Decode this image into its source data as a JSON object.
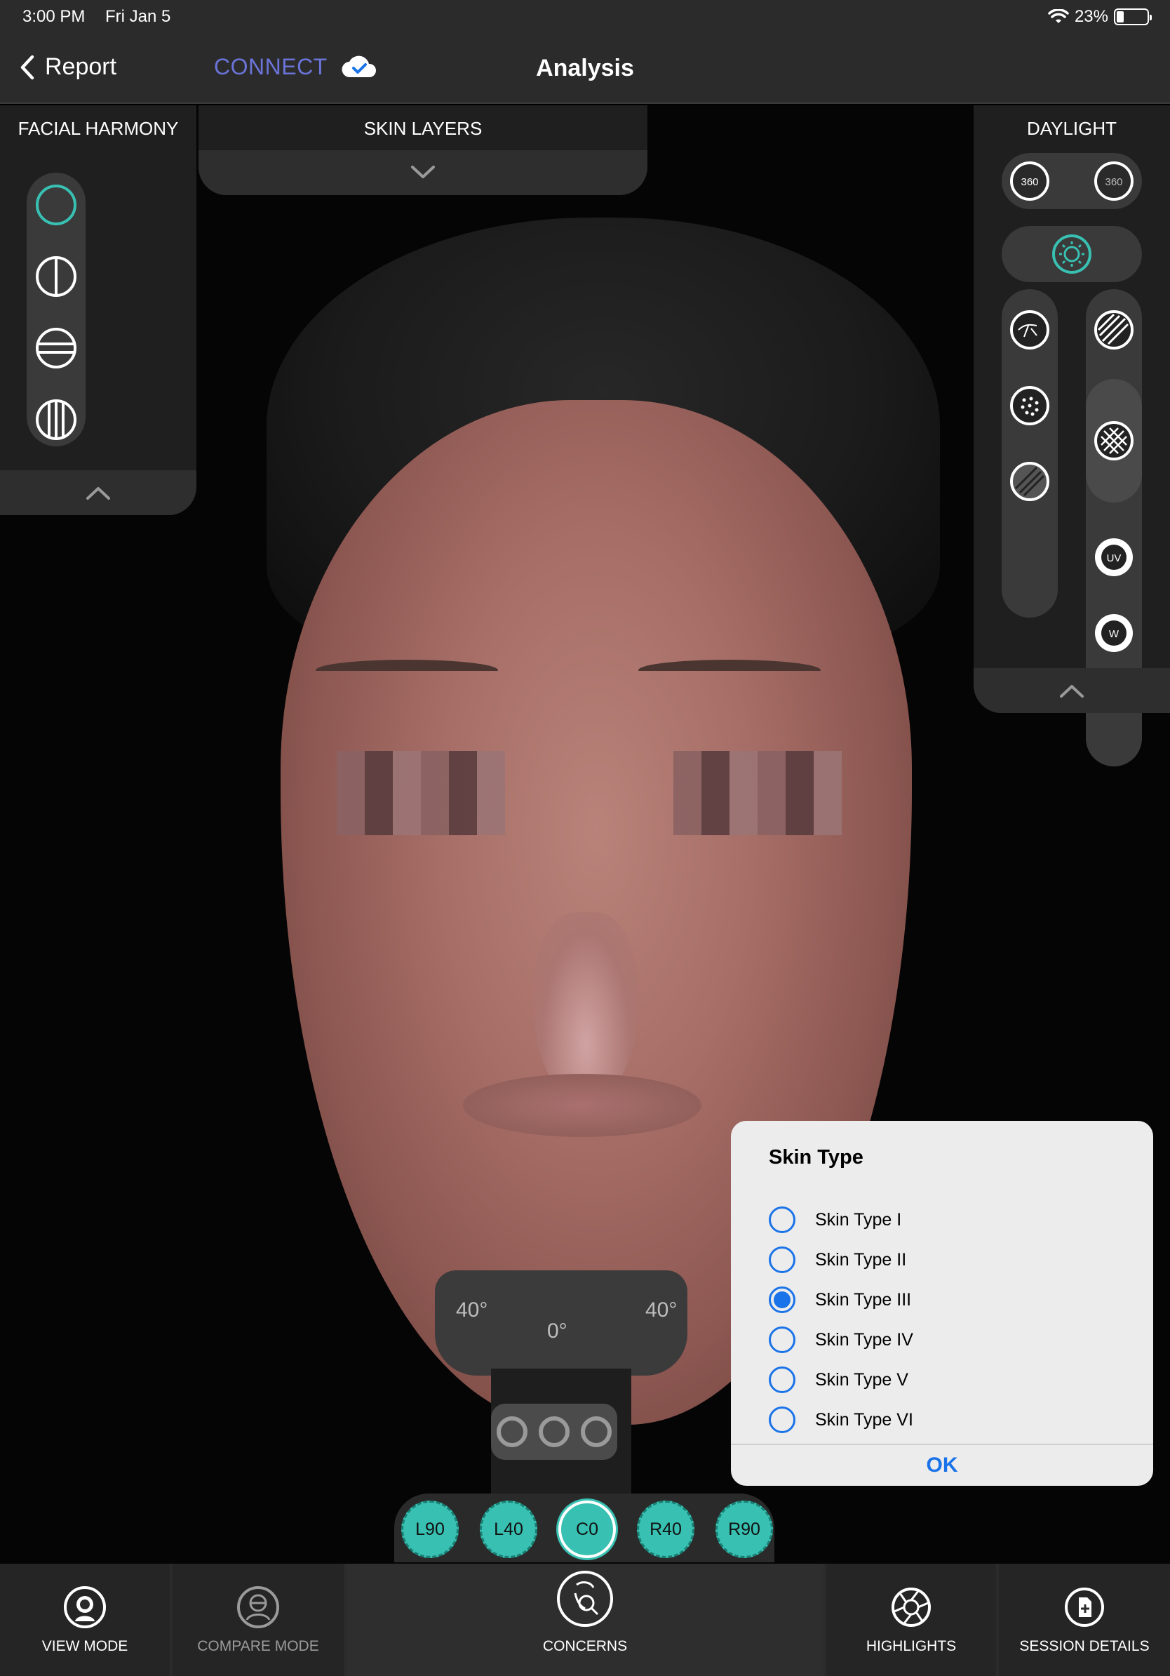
{
  "status": {
    "time": "3:00 PM",
    "date": "Fri Jan 5",
    "battery": "23%",
    "battery_level": 0.23
  },
  "nav": {
    "back_label": "Report",
    "connect_label": "CONNECT",
    "title": "Analysis"
  },
  "left_panel": {
    "title": "FACIAL HARMONY",
    "icons": [
      "circle-icon",
      "vertical-split-icon",
      "horizontal-split-icon",
      "vertical-thirds-icon"
    ]
  },
  "skin_layers": {
    "title": "SKIN LAYERS"
  },
  "right_panel": {
    "title": "DAYLIGHT",
    "badge_360": "360",
    "uv_label": "UV",
    "w_label": "W"
  },
  "chinrest": {
    "left_angle": "40°",
    "center_angle": "0°",
    "right_angle": "40°"
  },
  "modal": {
    "title": "Skin Type",
    "options": [
      "Skin Type I",
      "Skin Type II",
      "Skin Type III",
      "Skin Type IV",
      "Skin Type V",
      "Skin Type VI"
    ],
    "selected": "Skin Type III",
    "ok_label": "OK"
  },
  "angles": [
    "L90",
    "L40",
    "C0",
    "R40",
    "R90"
  ],
  "active_angle": "C0",
  "tabs": {
    "view_mode": "VIEW MODE",
    "compare_mode": "COMPARE MODE",
    "concerns": "CONCERNS",
    "highlights": "HIGHLIGHTS",
    "session_details": "SESSION DETAILS"
  },
  "colors": {
    "accent": "#38c1b2",
    "connect": "#6b74d9",
    "modal_blue": "#1a73e8",
    "panel": "#1f1f1f"
  }
}
